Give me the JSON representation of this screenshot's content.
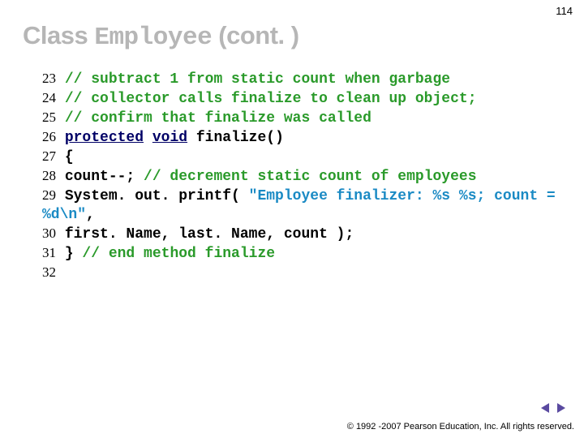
{
  "page_number": "114",
  "title": {
    "prefix": "Class ",
    "mono": "Employee",
    "suffix": " (cont. )"
  },
  "code": {
    "l23_num": "23",
    "l23_cmt": "// subtract 1 from static count when garbage",
    "l24_num": "24",
    "l24_cmt": "// collector calls finalize to clean up object;",
    "l25_num": "25",
    "l25_cmt": "// confirm that finalize was called",
    "l26_num": "26",
    "l26_kw1": "protected",
    "l26_kw2": "void",
    "l26_txt": " finalize()",
    "l27_num": "27",
    "l27_txt": "{",
    "l28_num": "28",
    "l28_txt": "   count--; ",
    "l28_cmt": "// decrement static count of employees",
    "l29_num": "29",
    "l29_txt": "   System. out. printf( ",
    "l29_str": "\"Employee finalizer: %s %s; count = %d\\n\"",
    "l29_txt2": ",",
    "l30_num": "30",
    "l30_txt": "      first. Name, last. Name, count );",
    "l31_num": "31",
    "l31_txt": "} ",
    "l31_cmt": "// end method finalize",
    "l32_num": "32"
  },
  "copyright": "© 1992 -2007 Pearson Education, Inc. All rights reserved."
}
